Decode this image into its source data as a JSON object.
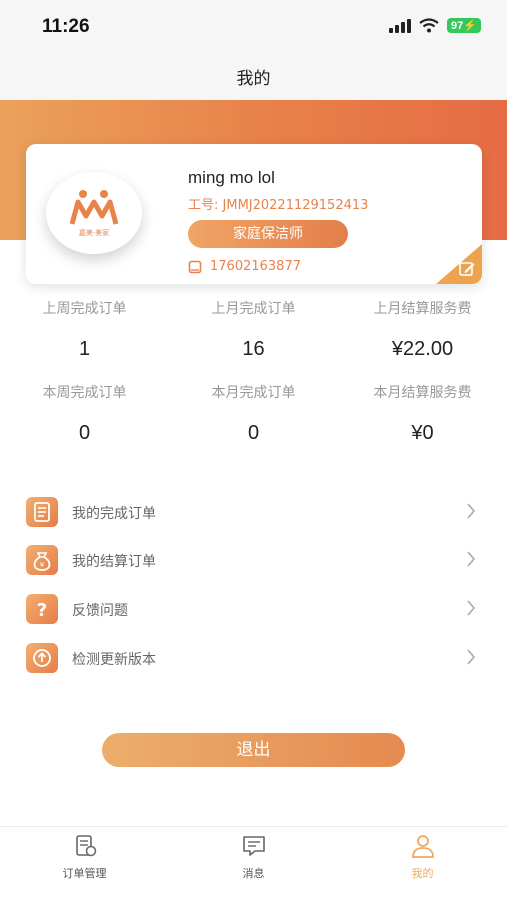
{
  "status": {
    "time": "11:26",
    "battery": "97"
  },
  "nav": {
    "title": "我的"
  },
  "profile": {
    "logo_text": "嘉美·美家",
    "name": "ming mo lol",
    "job_no": "工号: JMMJ20221129152413",
    "role": "家庭保洁师",
    "phone": "17602163877"
  },
  "stats": [
    {
      "label": "上周完成订单",
      "value": "1"
    },
    {
      "label": "上月完成订单",
      "value": "16"
    },
    {
      "label": "上月结算服务费",
      "value": "¥22.00"
    },
    {
      "label": "本周完成订单",
      "value": "0"
    },
    {
      "label": "本月完成订单",
      "value": "0"
    },
    {
      "label": "本月结算服务费",
      "value": "¥0"
    }
  ],
  "menu": [
    {
      "label": "我的完成订单",
      "icon": "document-icon"
    },
    {
      "label": "我的结算订单",
      "icon": "money-bag-icon"
    },
    {
      "label": "反馈问题",
      "icon": "question-icon"
    },
    {
      "label": "检测更新版本",
      "icon": "update-icon"
    }
  ],
  "logout": "退出",
  "tabs": [
    {
      "label": "订单管理",
      "icon": "orders-icon",
      "active": false
    },
    {
      "label": "消息",
      "icon": "message-icon",
      "active": false
    },
    {
      "label": "我的",
      "icon": "profile-icon",
      "active": true
    }
  ],
  "colors": {
    "accent": "#e8834c",
    "active_tab": "#f0a85f"
  }
}
